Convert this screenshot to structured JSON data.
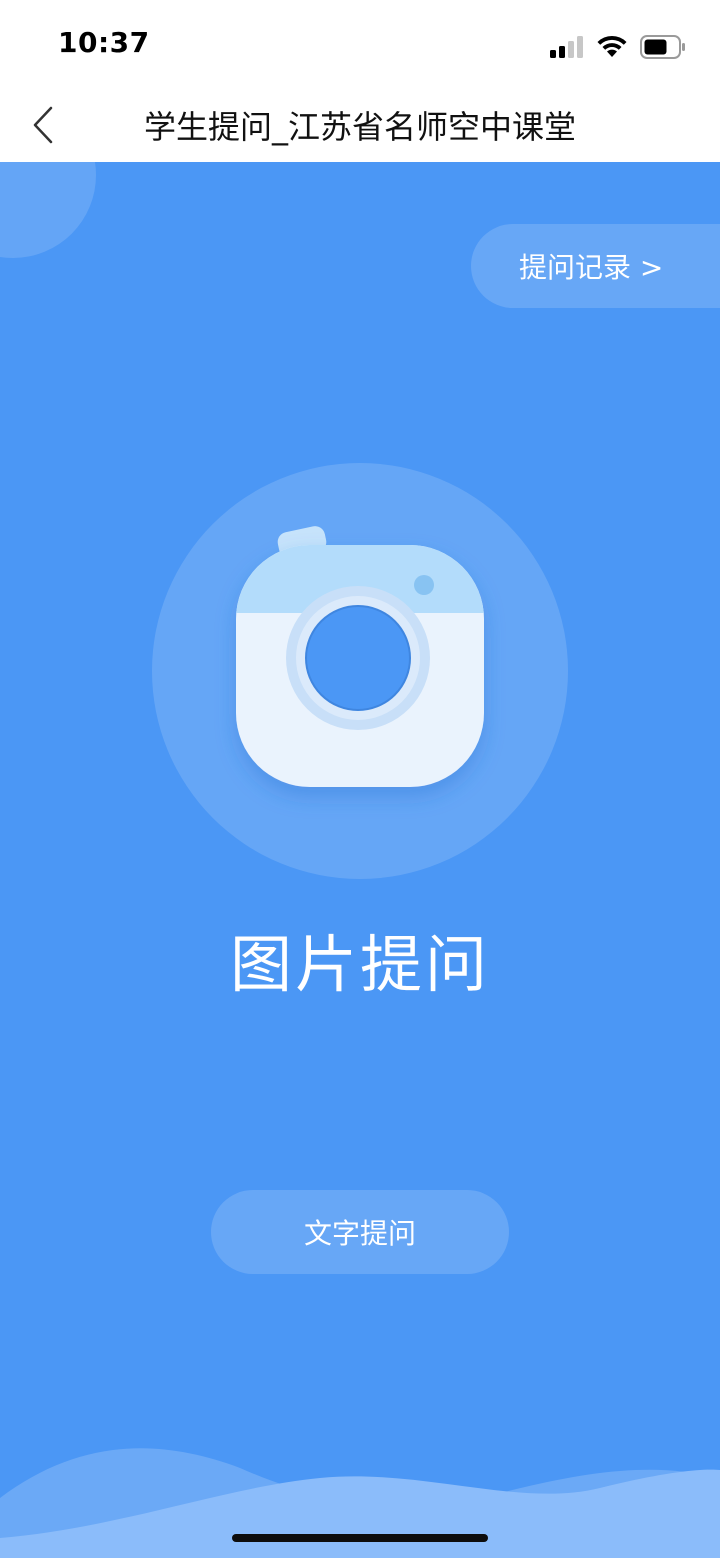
{
  "status_bar": {
    "time": "10:37",
    "icons": [
      "cellular-signal-icon",
      "wifi-icon",
      "battery-icon"
    ]
  },
  "nav": {
    "back_icon": "chevron-left-icon",
    "title": "学生提问_江苏省名师空中课堂"
  },
  "main": {
    "history_button_label": "提问记录 >",
    "camera_icon": "camera-icon",
    "image_question_label": "图片提问",
    "text_question_button_label": "文字提问"
  },
  "colors": {
    "background_blue": "#4b97f5",
    "camera_body": "#eaf3fd",
    "camera_top": "#b3dcfb",
    "lens_ring": "#c8dff8",
    "lens": "#4b97f5"
  }
}
